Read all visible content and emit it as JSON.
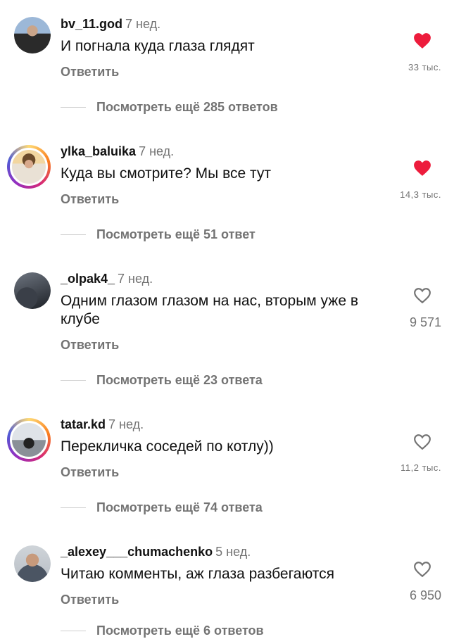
{
  "comments": [
    {
      "username": "bv_11.god",
      "time": "7 нед.",
      "text": "И погнала куда глаза глядят",
      "reply_label": "Ответить",
      "likes": "33 тыс.",
      "liked": true,
      "view_replies": "Посмотреть ещё 285 ответов",
      "avatar": "profile-photo"
    },
    {
      "username": "ylka_baluika",
      "time": "7 нед.",
      "text": "Куда вы смотрите? Мы все тут",
      "reply_label": "Ответить",
      "likes": "14,3 тыс.",
      "liked": true,
      "view_replies": "Посмотреть ещё 51 ответ",
      "avatar": "profile-photo-story-ring"
    },
    {
      "username": "_olpak4_",
      "time": "7 нед.",
      "text": "Одним глазом глазом на нас, вторым уже в клубе",
      "reply_label": "Ответить",
      "likes": "9 571",
      "liked": false,
      "view_replies": "Посмотреть ещё 23 ответа",
      "avatar": "profile-photo"
    },
    {
      "username": "tatar.kd",
      "time": "7 нед.",
      "text": "Перекличка соседей по котлу))",
      "reply_label": "Ответить",
      "likes": "11,2 тыс.",
      "liked": false,
      "view_replies": "Посмотреть ещё 74 ответа",
      "avatar": "profile-photo-story-ring"
    },
    {
      "username": "_alexey___chumachenko",
      "time": "5 нед.",
      "text": "Читаю комменты, аж глаза разбегаются",
      "reply_label": "Ответить",
      "likes": "6 950",
      "liked": false,
      "view_replies": "Посмотреть ещё 6 ответов",
      "avatar": "profile-photo"
    }
  ],
  "colors": {
    "like_active": "#ed1c3c",
    "muted_text": "#737373",
    "primary_text": "#111111"
  },
  "icons": {
    "like": "heart-icon",
    "like_active": "heart-filled-icon"
  }
}
